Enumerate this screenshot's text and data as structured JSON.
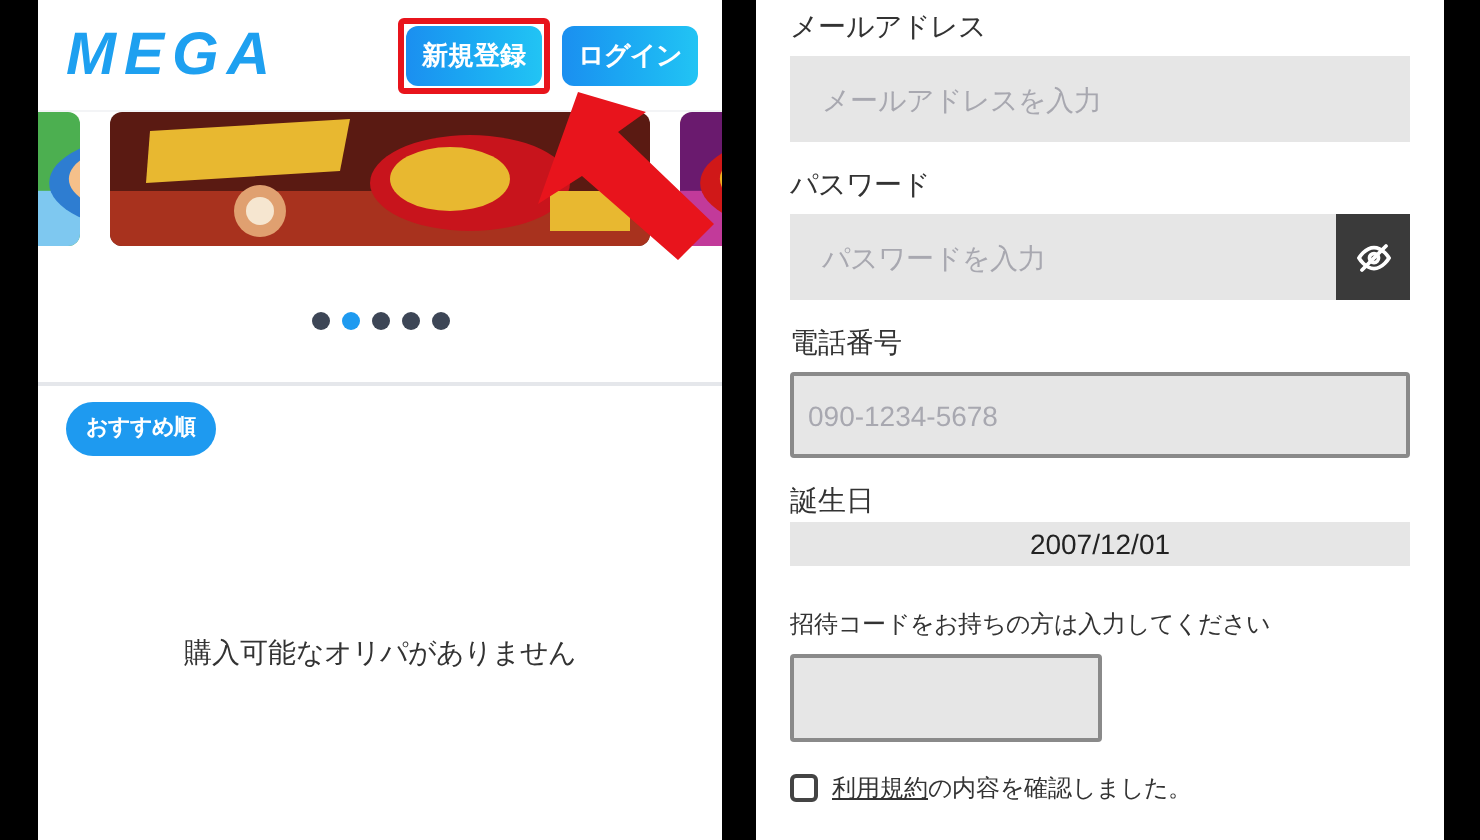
{
  "left": {
    "logo": "MEGA",
    "header_buttons": [
      {
        "label": "新規登録",
        "highlighted": true
      },
      {
        "label": "ログイン",
        "highlighted": false
      }
    ],
    "carousel": {
      "dots": [
        {
          "selected": false
        },
        {
          "selected": true
        },
        {
          "selected": false
        },
        {
          "selected": false
        },
        {
          "selected": false
        }
      ]
    },
    "sort_badge": "おすすめ順",
    "empty_message": "購入可能なオリパがありません"
  },
  "form": {
    "fields": [
      {
        "kind": "text",
        "label": "メールアドレス",
        "placeholder": "メールアドレスを入力"
      },
      {
        "kind": "password",
        "label": "パスワード",
        "placeholder": "パスワードを入力"
      },
      {
        "kind": "bordered",
        "label": "電話番号",
        "placeholder": "090-1234-5678"
      },
      {
        "kind": "date",
        "label": "誕生日",
        "value": "2007/12/01"
      },
      {
        "kind": "code",
        "label": "招待コードをお持ちの方は入力してください"
      }
    ],
    "terms": {
      "checked": false,
      "link": "利用規約",
      "text": "の内容を確認しました。"
    }
  }
}
